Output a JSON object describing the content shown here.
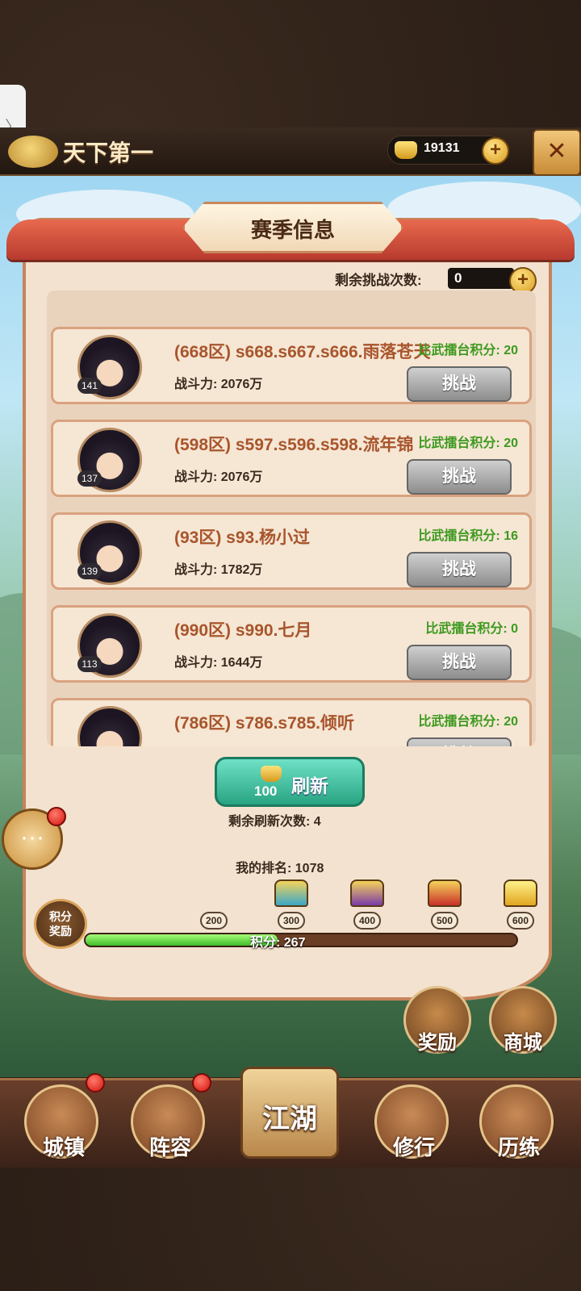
{
  "header": {
    "title": "天下第一",
    "gold": "19131",
    "plus": "+",
    "close": "✕"
  },
  "panel": {
    "title": "赛季信息",
    "remaining_label": "剩余挑战次数:",
    "remaining_value": "0"
  },
  "opponents": [
    {
      "name": "(668区) s668.s667.s666.雨落苍天",
      "power": "战斗力: 2076万",
      "score": "比武擂台积分: 20",
      "level": "141",
      "action": "挑战"
    },
    {
      "name": "(598区) s597.s596.s598.流年锦",
      "power": "战斗力: 2076万",
      "score": "比武擂台积分: 20",
      "level": "137",
      "action": "挑战"
    },
    {
      "name": "(93区) s93.杨小过",
      "power": "战斗力: 1782万",
      "score": "比武擂台积分: 16",
      "level": "139",
      "action": "挑战"
    },
    {
      "name": "(990区) s990.七月",
      "power": "战斗力: 1644万",
      "score": "比武擂台积分: 0",
      "level": "113",
      "action": "挑战"
    },
    {
      "name": "(786区) s786.s785.倾听",
      "power": "",
      "score": "比武擂台积分: 20",
      "level": "",
      "action": "挑战"
    }
  ],
  "refresh": {
    "cost": "100",
    "label": "刷新",
    "remaining": "剩余刷新次数: 4"
  },
  "rank": {
    "label": "我的排名: 1078"
  },
  "points": {
    "badge_line1": "积分",
    "badge_line2": "奖励",
    "milestones": [
      "200",
      "300",
      "400",
      "500",
      "600"
    ],
    "current_text": "积分: 267",
    "current": 267,
    "max": 600
  },
  "side_buttons": {
    "reward": "奖励",
    "shop": "商城"
  },
  "nav": {
    "town": "城镇",
    "lineup": "阵容",
    "jianghu": "江湖",
    "practice": "修行",
    "training": "历练"
  },
  "icons": {
    "chat": "chat-bubble-icon",
    "gold": "gold-ingot-icon",
    "close": "close-icon"
  }
}
